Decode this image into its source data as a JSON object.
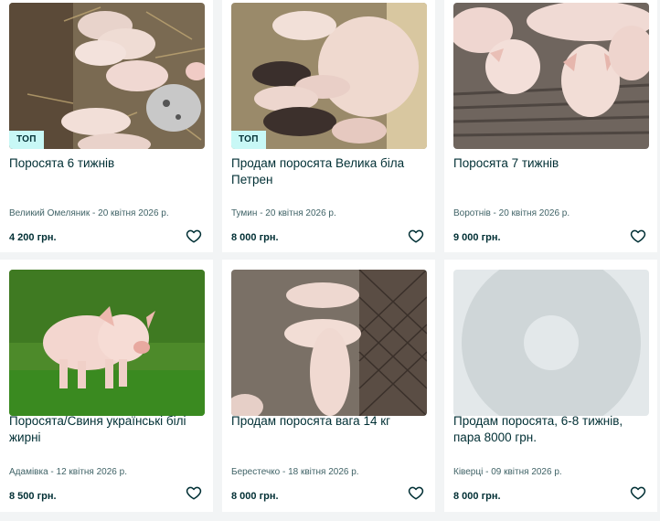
{
  "listings": [
    {
      "title": "Поросята 6 тижнів",
      "badge": "ТОП",
      "meta": "Великий Омеляник - 20 квітня 2026 р.",
      "price": "4 200 грн.",
      "image": "piglets-in-straw"
    },
    {
      "title": "Продам поросята Велика біла Петрен",
      "badge": "ТОП",
      "meta": "Тумин - 20 квітня 2026 р.",
      "price": "8 000 грн.",
      "image": "sow-with-piglets"
    },
    {
      "title": "Поросята 7 тижнів",
      "badge": "",
      "meta": "Воротнів - 20 квітня 2026 р.",
      "price": "9 000 грн.",
      "image": "pigs-on-slatted-floor"
    },
    {
      "title": "Поросята/Свиня українські білі жирні",
      "badge": "",
      "meta": "Адамівка - 12 квітня 2026 р.",
      "price": "8 500 грн.",
      "image": "piglet-on-grass"
    },
    {
      "title": "Продам поросята вага 14 кг",
      "badge": "",
      "meta": "Берестечко - 18 квітня 2026 р.",
      "price": "8 000 грн.",
      "image": "piglets-in-pen"
    },
    {
      "title": "Продам поросята, 6-8 тижнів, пара 8000 грн.",
      "badge": "",
      "meta": "Ківерці - 09 квітня 2026 р.",
      "price": "8 000 грн.",
      "image": "placeholder"
    }
  ],
  "icons": {
    "favorite": "heart-outline-icon"
  },
  "colors": {
    "badge_bg": "#c8f8f6",
    "text": "#002f34",
    "meta": "#406367",
    "page_bg": "#f2f4f5"
  }
}
